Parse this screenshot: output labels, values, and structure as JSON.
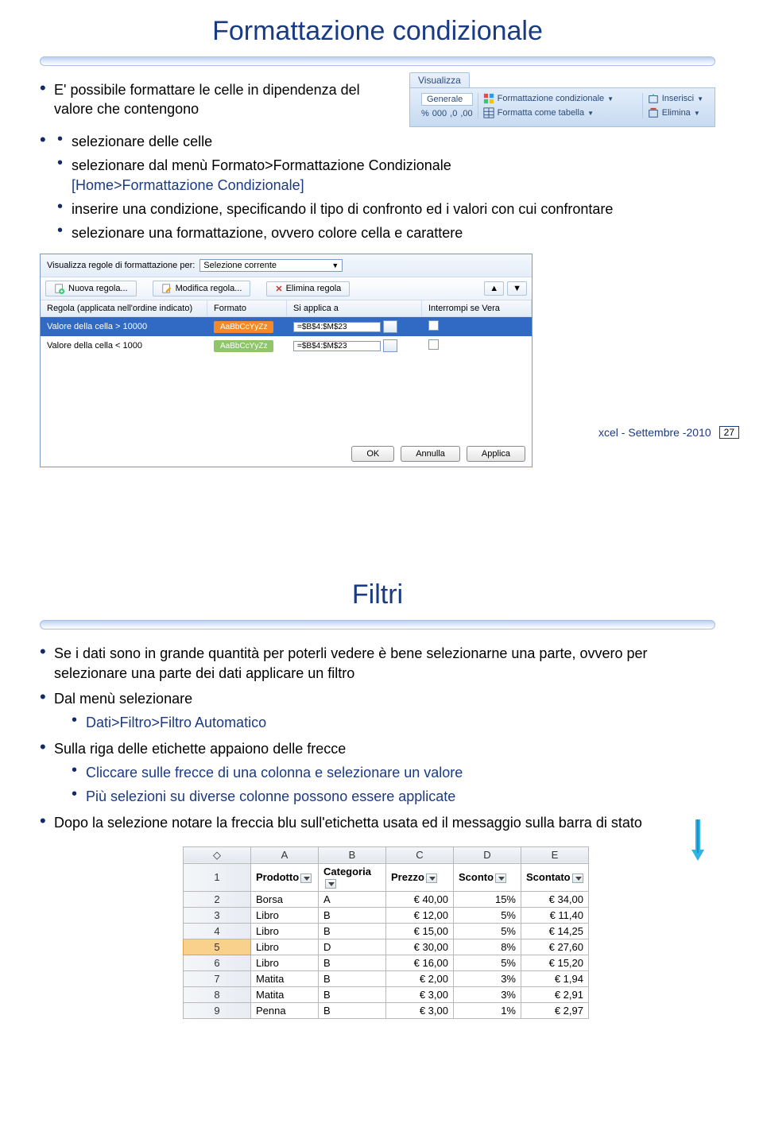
{
  "slide1": {
    "title": "Formattazione condizionale",
    "intro": "E' possibile formattare le celle in dipendenza del valore che contengono",
    "b1": "selezionare delle celle",
    "b2": "selezionare dal menù Formato>Formattazione Condizionale",
    "b2b": "[Home>Formattazione Condizionale]",
    "b3": "inserire una condizione, specificando il tipo di confronto ed i valori con cui confrontare",
    "b4": "selezionare una formattazione, ovvero colore cella e carattere",
    "footer_text": "xcel - Settembre -2010",
    "footer_page": "27"
  },
  "ribbon": {
    "tab": "Visualizza",
    "group_label": "Generale",
    "fmt_cond": "Formattazione condizionale",
    "fmt_table": "Formatta come tabella",
    "ins": "Inserisci",
    "del": "Elimina",
    "sym_pct": "%",
    "sym_000": "000",
    "sym_dec1": ",0",
    "sym_dec2": ",00"
  },
  "dialog": {
    "label1": "Visualizza regole di formattazione per:",
    "select_val": "Selezione corrente",
    "new_rule": "Nuova regola...",
    "edit_rule": "Modifica regola...",
    "del_rule": "Elimina regola",
    "hdr_rule": "Regola (applicata nell'ordine indicato)",
    "hdr_fmt": "Formato",
    "hdr_applies": "Si applica a",
    "hdr_stop": "Interrompi se Vera",
    "rule1": "Valore della cella > 10000",
    "rule2": "Valore della cella < 1000",
    "sample": "AaBbCcYyZz",
    "ref": "=$B$4:$M$23",
    "ok": "OK",
    "cancel": "Annulla",
    "apply": "Applica"
  },
  "slide2": {
    "title": "Filtri",
    "b1": "Se i dati sono in grande quantità per poterli vedere è bene selezionarne una parte, ovvero per selezionare una parte dei dati applicare un filtro",
    "b2": "Dal menù selezionare",
    "b2a": "Dati>Filtro>Filtro Automatico",
    "b3": "Sulla riga delle etichette appaiono delle frecce",
    "b3a": "Cliccare sulle frecce di una colonna e selezionare un valore",
    "b3b": "Più selezioni su diverse colonne possono essere applicate",
    "b4": "Dopo la selezione notare la freccia blu sull'etichetta usata ed il messaggio sulla barra di stato"
  },
  "table": {
    "cols": [
      "A",
      "B",
      "C",
      "D",
      "E"
    ],
    "headers": [
      "Prodotto",
      "Categoria",
      "Prezzo",
      "Sconto",
      "Scontato"
    ],
    "rows": [
      [
        "Borsa",
        "A",
        "€ 40,00",
        "15%",
        "€ 34,00"
      ],
      [
        "Libro",
        "B",
        "€ 12,00",
        "5%",
        "€ 11,40"
      ],
      [
        "Libro",
        "B",
        "€ 15,00",
        "5%",
        "€ 14,25"
      ],
      [
        "Libro",
        "D",
        "€ 30,00",
        "8%",
        "€ 27,60"
      ],
      [
        "Libro",
        "B",
        "€ 16,00",
        "5%",
        "€ 15,20"
      ],
      [
        "Matita",
        "B",
        "€ 2,00",
        "3%",
        "€ 1,94"
      ],
      [
        "Matita",
        "B",
        "€ 3,00",
        "3%",
        "€ 2,91"
      ],
      [
        "Penna",
        "B",
        "€ 3,00",
        "1%",
        "€ 2,97"
      ]
    ],
    "rownums": [
      "1",
      "2",
      "3",
      "4",
      "5",
      "6",
      "7",
      "8",
      "9"
    ]
  }
}
